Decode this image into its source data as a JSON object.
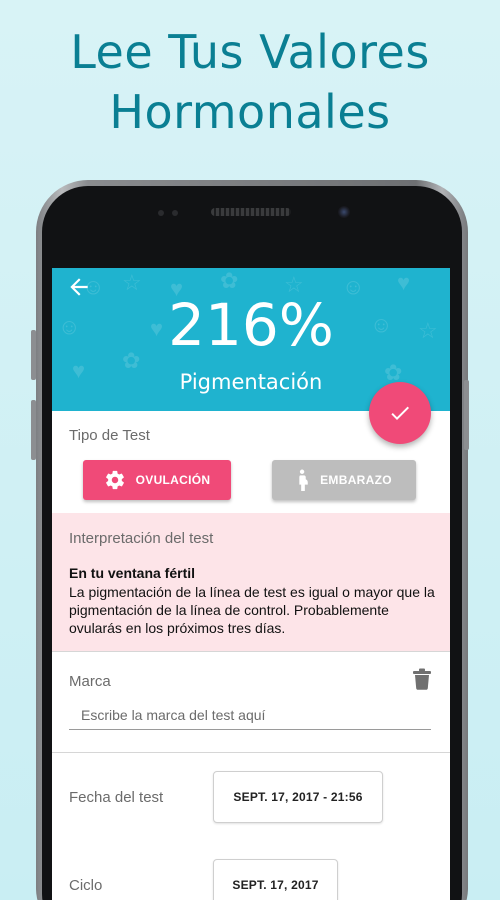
{
  "promo": {
    "title_line1": "Lee Tus Valores",
    "title_line2": "Hormonales"
  },
  "header": {
    "percentage": "216%",
    "percentage_label": "Pigmentación",
    "accent_color": "#1fb3cf"
  },
  "test_type": {
    "label": "Tipo de Test",
    "ovulation_button": "OVULACIÓN",
    "pregnancy_button": "EMBARAZO",
    "selected": "OVULACIÓN",
    "selected_color": "#f04a78",
    "unselected_color": "#bdbdbd"
  },
  "interpretation": {
    "title": "Interpretación del test",
    "heading": "En tu ventana fértil",
    "body": "La pigmentación de la línea de test es igual o mayor que la pigmentación de la línea de control. Probablemente ovularás en los próximos tres días.",
    "background_color": "#fde4e8"
  },
  "brand": {
    "label": "Marca",
    "placeholder": "Escribe la marca del test aquí"
  },
  "test_date": {
    "label": "Fecha del test",
    "value": "SEPT. 17, 2017 - 21:56"
  },
  "cycle": {
    "label": "Ciclo",
    "value": "SEPT. 17, 2017"
  },
  "icons": {
    "back": "arrow-left-icon",
    "confirm": "check-icon",
    "ovulation": "gear-flower-icon",
    "pregnancy": "pregnant-woman-icon",
    "delete": "trash-icon"
  }
}
